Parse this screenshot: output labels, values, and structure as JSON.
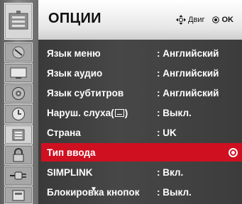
{
  "header": {
    "title": "ОПЦИИ",
    "move_label": "Двиг",
    "ok_label": "OK"
  },
  "sidebar": {
    "items": [
      {
        "icon": "tv-setup-icon"
      },
      {
        "icon": "picture-icon"
      },
      {
        "icon": "screen-icon"
      },
      {
        "icon": "audio-icon"
      },
      {
        "icon": "time-icon"
      },
      {
        "icon": "option-icon",
        "active": true
      },
      {
        "icon": "lock-icon"
      },
      {
        "icon": "input-icon"
      },
      {
        "icon": "usb-icon"
      }
    ]
  },
  "menu": {
    "items": [
      {
        "label": "Язык меню",
        "value": ": Английский"
      },
      {
        "label": "Язык аудио",
        "value": ": Английский"
      },
      {
        "label": "Язык субтитров",
        "value": ": Английский"
      },
      {
        "label": "Наруш. слуха(",
        "label_suffix": ")",
        "value": ": Выкл."
      },
      {
        "label": "Страна",
        "value": ": UK"
      },
      {
        "label": "Тип ввода",
        "value": "",
        "selected": true
      },
      {
        "label": "SIMPLINK",
        "value": ": Вкл."
      },
      {
        "label": "Блокировка кнопок",
        "value": ": Выкл."
      }
    ],
    "more_below": "▼"
  },
  "colors": {
    "selected_row": "#cf1021",
    "panel": "#424242",
    "header": "#efefef"
  }
}
